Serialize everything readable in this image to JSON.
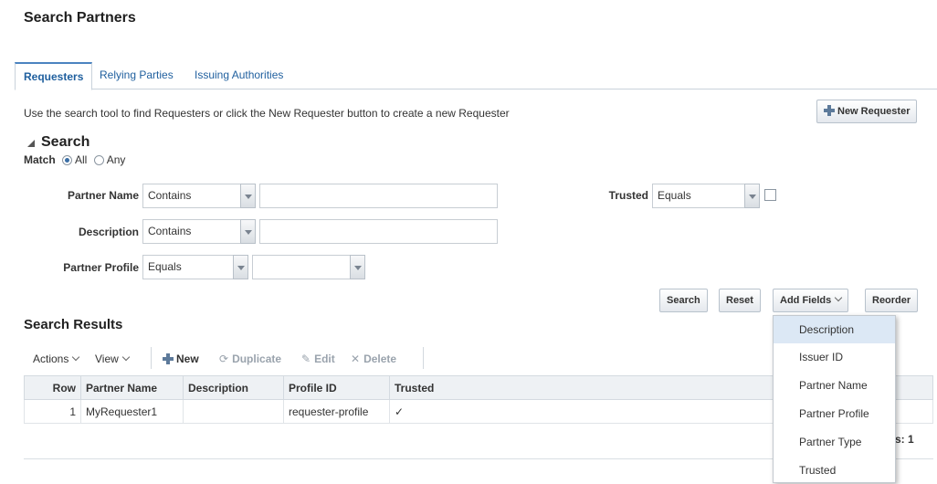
{
  "page": {
    "title": "Search Partners"
  },
  "tabs": [
    "Requesters",
    "Relying Parties",
    "Issuing Authorities"
  ],
  "intro_text": "Use the search tool to find Requesters or click the New Requester button to create a new Requester",
  "new_button_label": "New Requester",
  "search": {
    "title": "Search",
    "match_label": "Match",
    "match_all": "All",
    "match_any": "Any",
    "match_selected": "All",
    "fields": {
      "partner_name": {
        "label": "Partner Name",
        "operator": "Contains",
        "value": ""
      },
      "description": {
        "label": "Description",
        "operator": "Contains",
        "value": ""
      },
      "partner_profile": {
        "label": "Partner Profile",
        "operator": "Equals",
        "value": ""
      },
      "trusted": {
        "label": "Trusted",
        "operator": "Equals",
        "checked": false
      }
    },
    "buttons": {
      "search": "Search",
      "reset": "Reset",
      "add_fields": "Add Fields",
      "reorder": "Reorder"
    }
  },
  "results": {
    "title": "Search Results",
    "toolbar": {
      "actions": "Actions",
      "view": "View",
      "new": "New",
      "duplicate": "Duplicate",
      "edit": "Edit",
      "delete": "Delete"
    },
    "columns": [
      "Row",
      "Partner Name",
      "Description",
      "Profile ID",
      "Trusted"
    ],
    "rows": [
      {
        "row": "1",
        "partner_name": "MyRequester1",
        "description": "",
        "profile_id": "requester-profile",
        "trusted": "✓"
      }
    ],
    "count_suffix": "s: 1"
  },
  "add_fields_menu": [
    "Description",
    "Issuer ID",
    "Partner Name",
    "Partner Profile",
    "Partner Type",
    "Trusted"
  ],
  "colors": {
    "link": "#1f5f9e",
    "tab_accent": "#4b83c0",
    "menu_highlight": "#dce8f5"
  }
}
